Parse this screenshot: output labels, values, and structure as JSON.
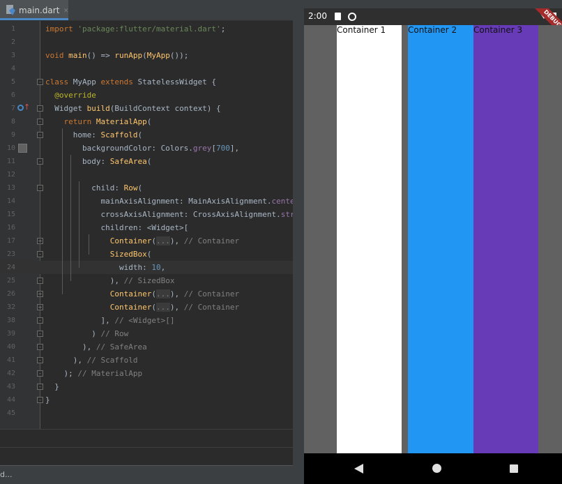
{
  "ide": {
    "tab_label": "main.dart",
    "status_text": "d...",
    "current_line": "24",
    "lines": [
      {
        "no": "1",
        "html": "<span class='k'>import</span> <span class='s'>'package:flutter/material.dart'</span>;"
      },
      {
        "no": "2",
        "html": ""
      },
      {
        "no": "3",
        "html": "<span class='k'>void</span> <span class='fn'>main</span>() => <span class='fn'>runApp</span>(<span class='cls'>MyApp</span>());"
      },
      {
        "no": "4",
        "html": ""
      },
      {
        "no": "5",
        "html": "<span class='k'>class</span> MyApp <span class='k'>extends</span> StatelessWidget {"
      },
      {
        "no": "6",
        "html": "  <span class='an'>@override</span>"
      },
      {
        "no": "7",
        "html": "  Widget <span class='fn'>build</span>(BuildContext context) {"
      },
      {
        "no": "8",
        "html": "    <span class='k'>return</span> <span class='cls'>MaterialApp</span>("
      },
      {
        "no": "9",
        "html": "      home: <span class='cls'>Scaffold</span>("
      },
      {
        "no": "10",
        "html": "        backgroundColor: Colors.<span class='pr'>grey</span>[<span class='num'>700</span>],"
      },
      {
        "no": "11",
        "html": "        body: <span class='cls'>SafeArea</span>("
      },
      {
        "no": "12",
        "html": ""
      },
      {
        "no": "13",
        "html": "          child: <span class='cls'>Row</span>("
      },
      {
        "no": "14",
        "html": "            mainAxisAlignment: MainAxisAlignment.<span class='pr'>center</span>,"
      },
      {
        "no": "15",
        "html": "            crossAxisAlignment: CrossAxisAlignment.<span class='pr'>stretch</span>,"
      },
      {
        "no": "16",
        "html": "            children: &lt;Widget&gt;["
      },
      {
        "no": "17",
        "html": "              <span class='cls'>Container</span>(<span class='fold-inline'>...</span>), <span class='cm'>// Container</span>"
      },
      {
        "no": "23",
        "html": "              <span class='cls'>SizedBox</span>("
      },
      {
        "no": "24",
        "html": "                width: <span class='num'>10</span>,"
      },
      {
        "no": "25",
        "html": "              ), <span class='cm'>// SizedBox</span>"
      },
      {
        "no": "26",
        "html": "              <span class='cls'>Container</span>(<span class='fold-inline'>...</span>), <span class='cm'>// Container</span>"
      },
      {
        "no": "32",
        "html": "              <span class='cls'>Container</span>(<span class='fold-inline'>...</span>), <span class='cm'>// Container</span>"
      },
      {
        "no": "38",
        "html": "            ], <span class='cm'>// &lt;Widget&gt;[]</span>"
      },
      {
        "no": "39",
        "html": "          ) <span class='cm'>// Row</span>"
      },
      {
        "no": "40",
        "html": "        ), <span class='cm'>// SafeArea</span>"
      },
      {
        "no": "41",
        "html": "      ), <span class='cm'>// Scaffold</span>"
      },
      {
        "no": "42",
        "html": "    ); <span class='cm'>// MaterialApp</span>"
      },
      {
        "no": "43",
        "html": "  }"
      },
      {
        "no": "44",
        "html": "}"
      },
      {
        "no": "45",
        "html": ""
      }
    ],
    "fold_markers": {
      "5": "-",
      "7": "-",
      "8": "-",
      "9": "-",
      "11": "-",
      "13": "-",
      "17": "+",
      "23": "-",
      "25": "-",
      "26": "+",
      "32": "+",
      "38": "-",
      "39": "-",
      "40": "-",
      "41": "-",
      "42": "-",
      "43": "-",
      "44": "-"
    }
  },
  "phone": {
    "time": "2:00",
    "debug_label": "DEBUG",
    "background": "#616161",
    "containers": [
      {
        "label": "Container 1",
        "color": "#ffffff"
      },
      {
        "label": "Container 2",
        "color": "#2196f3"
      },
      {
        "label": "Container 3",
        "color": "#673ab7"
      }
    ]
  }
}
